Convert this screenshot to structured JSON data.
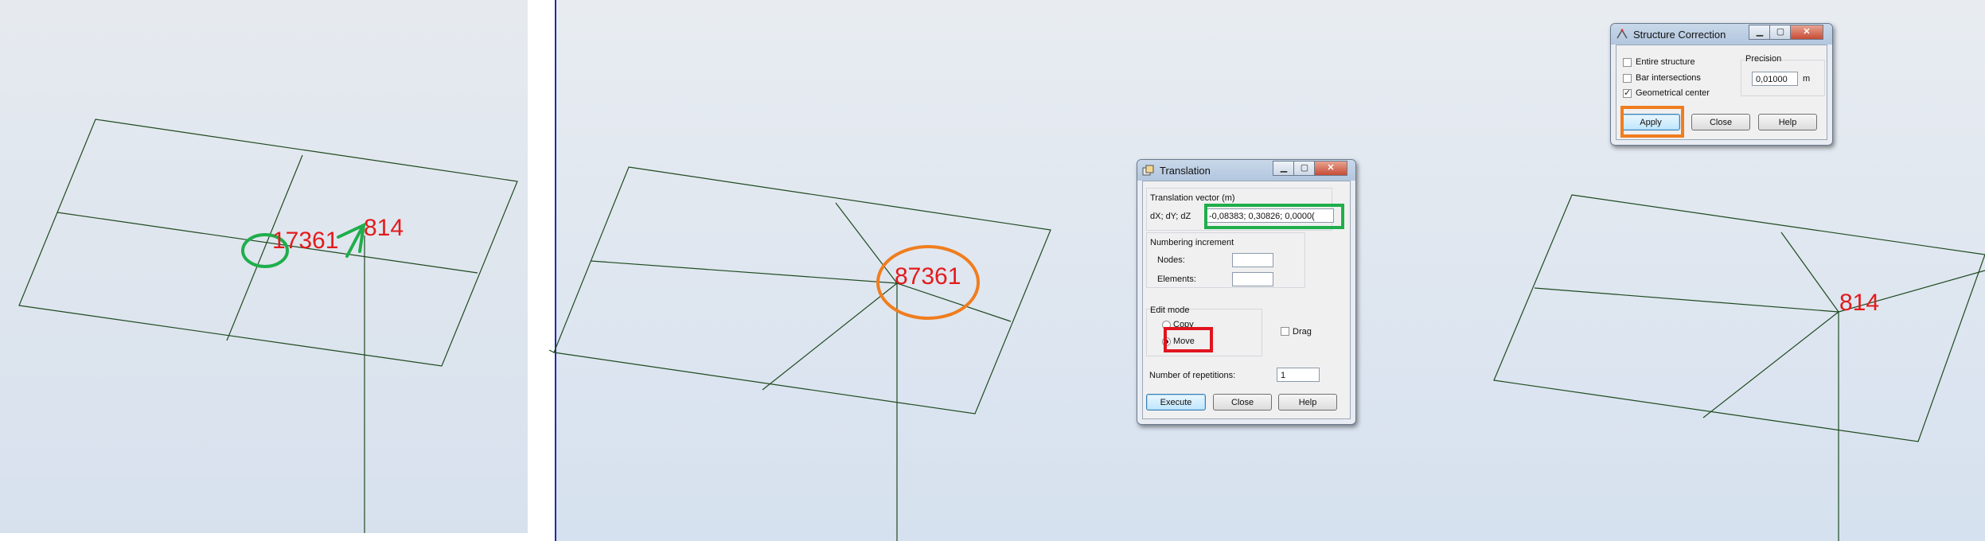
{
  "viewport_left": {
    "node_labels": {
      "left": "17361",
      "right": "814"
    }
  },
  "viewport_middle": {
    "node_label_overlap": "87361"
  },
  "viewport_right": {
    "node_label": "814"
  },
  "translation_dialog": {
    "title": "Translation",
    "icon": "translation-app-icon",
    "vector_group_label": "Translation vector (m)",
    "dxdydz_label": "dX; dY; dZ",
    "dxdydz_value": "-0,08383; 0,30826; 0,0000(",
    "numbering_group_label": "Numbering increment",
    "nodes_label": "Nodes:",
    "nodes_value": "",
    "elements_label": "Elements:",
    "elements_value": "",
    "edit_mode_label": "Edit mode",
    "copy_label": "Copy",
    "move_label": "Move",
    "drag_label": "Drag",
    "repetitions_label": "Number of repetitions:",
    "repetitions_value": "1",
    "execute_label": "Execute",
    "close_label": "Close",
    "help_label": "Help"
  },
  "structure_dialog": {
    "title": "Structure Correction",
    "icon": "structure-correction-app-icon",
    "entire_structure_label": "Entire structure",
    "bar_intersections_label": "Bar intersections",
    "geometrical_center_label": "Geometrical center",
    "precision_label": "Precision",
    "precision_value": "0,01000",
    "precision_unit": "m",
    "apply_label": "Apply",
    "close_label": "Close",
    "help_label": "Help"
  },
  "colors": {
    "label_red": "#e31b1b",
    "annotation_green": "#1fae4b",
    "annotation_orange": "#f07d1e",
    "annotation_red": "#e0151f",
    "structure_line": "#1f4a1f"
  }
}
